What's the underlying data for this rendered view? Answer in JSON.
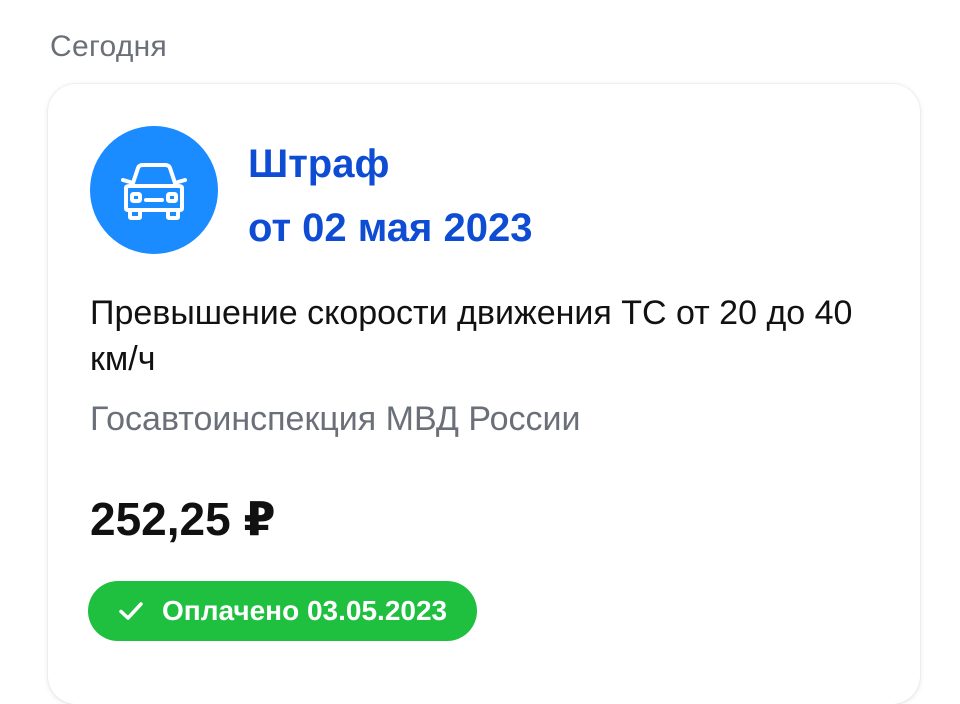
{
  "section": {
    "label": "Сегодня"
  },
  "fine": {
    "icon": "car-icon",
    "title": "Штраф",
    "date": "от 02 мая 2023",
    "description": "Превышение скорости движения ТС от 20 до 40 км/ч",
    "issuer": "Госавтоинспекция МВД России",
    "amount": "252,25 ₽",
    "status": {
      "icon": "checkmark-icon",
      "label": "Оплачено 03.05.2023",
      "color": "#1fbf3f"
    }
  },
  "colors": {
    "accent": "#0d4cd3",
    "icon_bg": "#1a8cff",
    "muted_text": "#6b6f78",
    "paid_badge": "#1fbf3f"
  }
}
